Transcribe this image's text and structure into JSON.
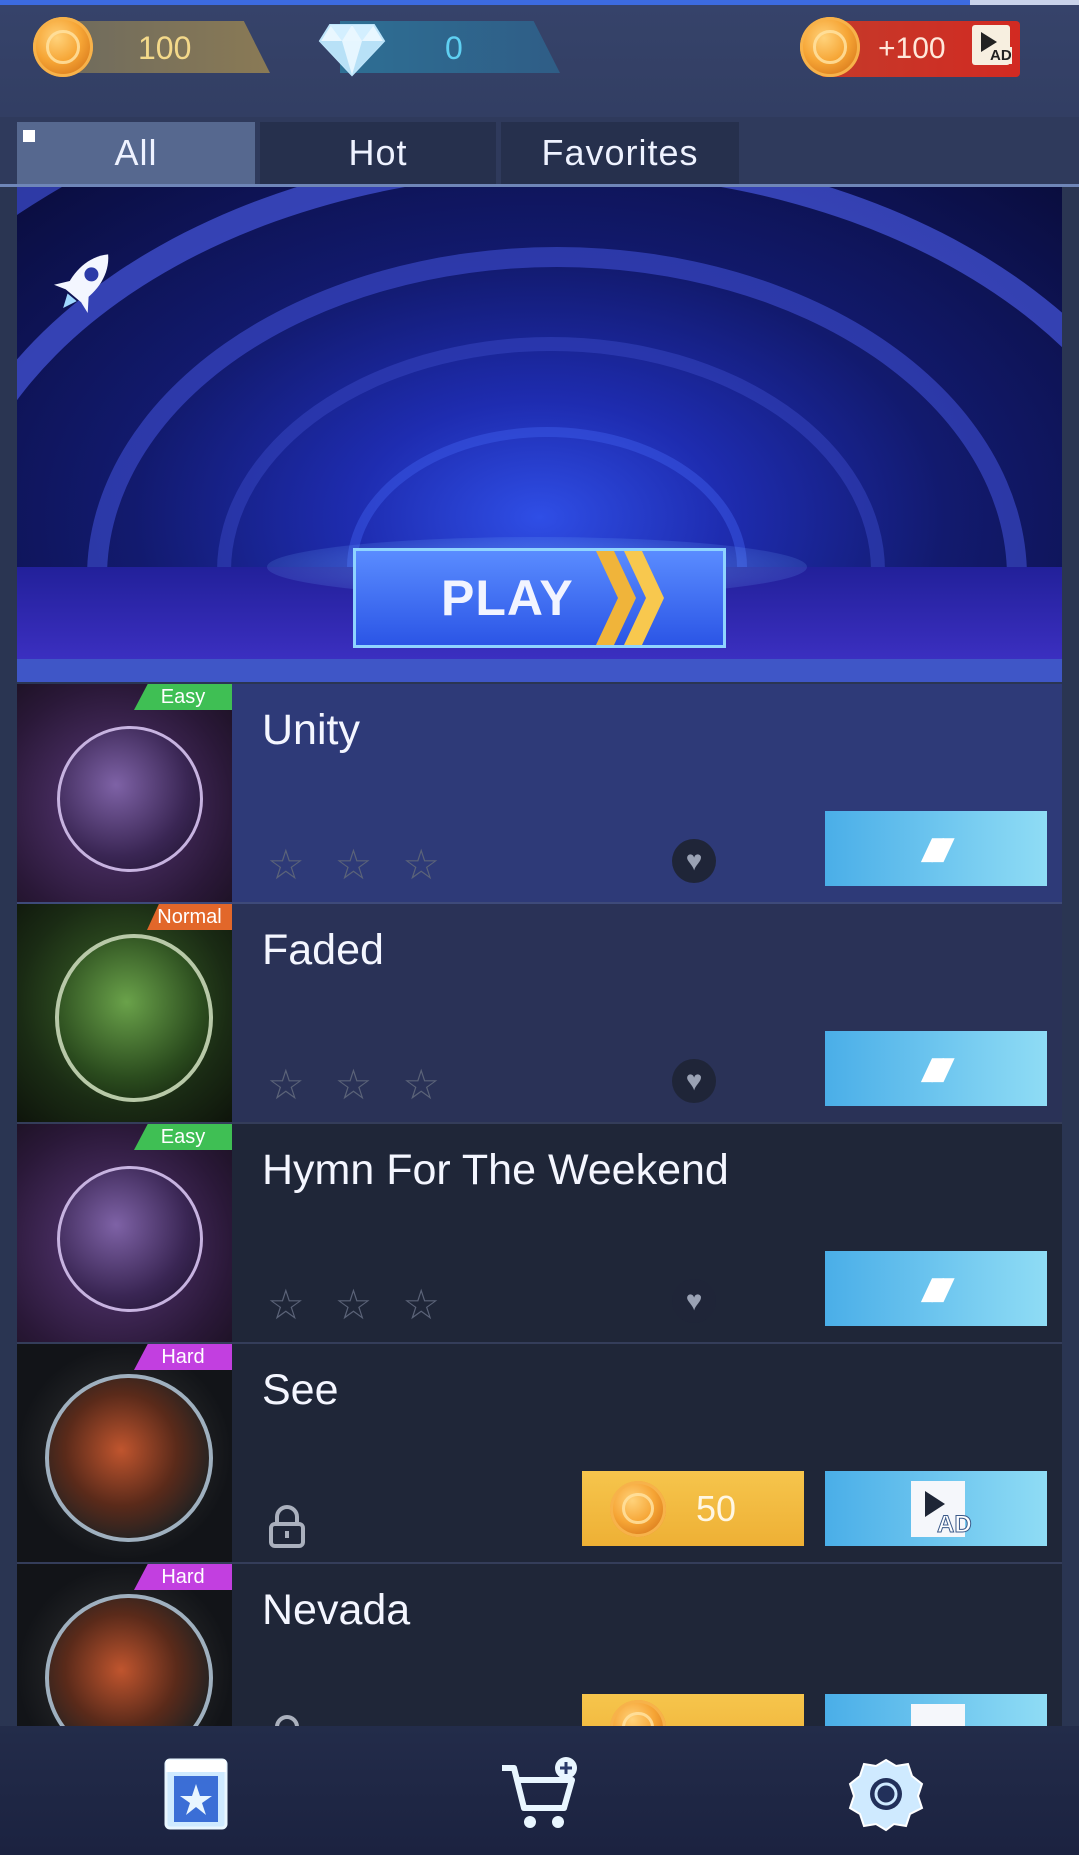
{
  "currency": {
    "coins": "100",
    "gems": "0",
    "ad_reward": "+100",
    "ad_label": "AD"
  },
  "tabs": [
    {
      "label": "All",
      "active": true
    },
    {
      "label": "Hot",
      "active": false
    },
    {
      "label": "Favorites",
      "active": false
    }
  ],
  "banner": {
    "play_label": "PLAY",
    "icon": "rocket-icon"
  },
  "songs": [
    {
      "title": "Unity",
      "difficulty": "Easy",
      "difficulty_color": "#3fbf54",
      "stars_earned": 0,
      "stars_total": 3,
      "locked": false,
      "row_bg": "#2e3a78"
    },
    {
      "title": "Faded",
      "difficulty": "Normal",
      "difficulty_color": "#e2672a",
      "stars_earned": 0,
      "stars_total": 3,
      "locked": false,
      "row_bg": "#2a3257"
    },
    {
      "title": "Hymn For The Weekend",
      "difficulty": "Easy",
      "difficulty_color": "#3fbf54",
      "stars_earned": 0,
      "stars_total": 3,
      "locked": false,
      "row_bg": "#1f2638"
    },
    {
      "title": "See",
      "difficulty": "Hard",
      "difficulty_color": "#c23fe0",
      "locked": true,
      "unlock_cost": "50",
      "ad_label": "AD",
      "row_bg": "#1f2638"
    },
    {
      "title": "Nevada",
      "difficulty": "Hard",
      "difficulty_color": "#c23fe0",
      "locked": true,
      "row_bg": "#1f2638"
    }
  ],
  "bottom_nav": [
    {
      "icon": "library-star-icon"
    },
    {
      "icon": "shop-cart-icon"
    },
    {
      "icon": "settings-gear-icon"
    }
  ],
  "colors": {
    "accent_blue": "#4aaee8",
    "coin_gold": "#f6a535",
    "gem_cyan": "#5fd0f2"
  }
}
